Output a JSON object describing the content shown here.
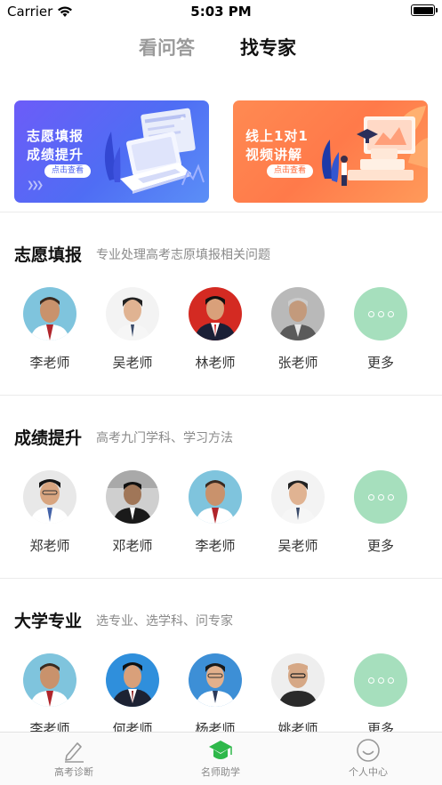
{
  "status_bar": {
    "carrier": "Carrier",
    "time": "5:03 PM"
  },
  "top_tabs": [
    {
      "label": "看问答",
      "active": false
    },
    {
      "label": "找专家",
      "active": true
    }
  ],
  "banners": [
    {
      "line1": "志愿填报",
      "line2": "成绩提升",
      "button": "点击查看"
    },
    {
      "line1": "线上1对1",
      "line2": "视频讲解",
      "button": "点击查看"
    }
  ],
  "sections": [
    {
      "title": "志愿填报",
      "subtitle": "专业处理高考志原填报相关问题",
      "teachers": [
        "李老师",
        "吴老师",
        "林老师",
        "张老师"
      ],
      "more_label": "更多"
    },
    {
      "title": "成绩提升",
      "subtitle": "高考九门学科、学习方法",
      "teachers": [
        "郑老师",
        "邓老师",
        "李老师",
        "吴老师"
      ],
      "more_label": "更多"
    },
    {
      "title": "大学专业",
      "subtitle": "选专业、选学科、问专家",
      "teachers": [
        "李老师",
        "何老师",
        "杨老师",
        "姚老师"
      ],
      "more_label": "更多"
    }
  ],
  "tab_bar": [
    {
      "label": "高考诊断",
      "icon": "pencil-icon",
      "active": false
    },
    {
      "label": "名师助学",
      "icon": "graduation-cap-icon",
      "active": true
    },
    {
      "label": "个人中心",
      "icon": "smiley-face-icon",
      "active": false
    }
  ],
  "colors": {
    "accent": "#32c24d",
    "more_circle": "#a6dfbd",
    "banner_left": "#5a64f5",
    "banner_right": "#ff7e4c"
  }
}
